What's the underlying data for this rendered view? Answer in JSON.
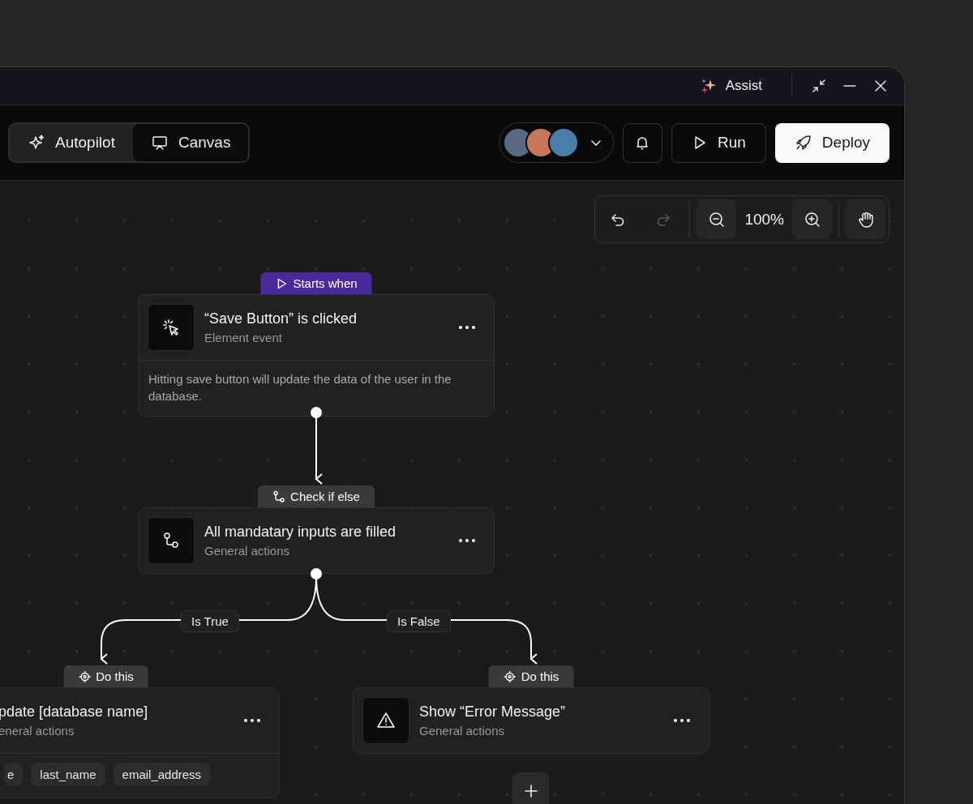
{
  "title_bar": {
    "assist_label": "Assist"
  },
  "mode_tabs": [
    {
      "label": "Autopilot",
      "kind": "sparkle",
      "selected": false
    },
    {
      "label": "Canvas",
      "kind": "screen",
      "selected": true
    }
  ],
  "actions": {
    "run": "Run",
    "deploy": "Deploy"
  },
  "history": [
    {
      "kind": "undo",
      "disabled": false
    },
    {
      "kind": "redo",
      "disabled": true
    }
  ],
  "zoom_level": "100%",
  "nodes": [
    {
      "tag": {
        "label": "Starts when",
        "kind": "trigger"
      },
      "title": "“Save Button” is clicked",
      "subtitle": "Element event",
      "description": "Hitting save button will update the data of the user in the database."
    },
    {
      "tag": {
        "label": "Check if else",
        "kind": "condition"
      },
      "title": "All mandatary inputs are filled",
      "subtitle": "General actions"
    },
    {
      "tag": {
        "label": "Do this",
        "kind": "action"
      },
      "title": "pdate [database name]",
      "subtitle": "eneral actions",
      "fields": [
        "e",
        "last_name",
        "email_address"
      ]
    },
    {
      "tag": {
        "label": "Do this",
        "kind": "action"
      },
      "title": "Show “Error Message”",
      "subtitle": "General actions"
    }
  ],
  "branches": [
    {
      "label": "Is True"
    },
    {
      "label": "Is False"
    }
  ]
}
